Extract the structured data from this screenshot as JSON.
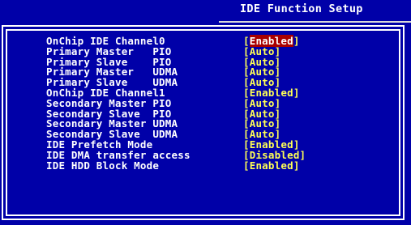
{
  "screen": {
    "title": "IDE Function Setup"
  },
  "colors": {
    "background": "#0000a8",
    "label": "#ffffff",
    "value": "#ffff54",
    "selected_bg": "#a80000"
  },
  "settings": [
    {
      "label": "OnChip IDE Channel0",
      "value": "Enabled",
      "selected": true
    },
    {
      "label": "Primary Master   PIO",
      "value": "Auto",
      "selected": false
    },
    {
      "label": "Primary Slave    PIO",
      "value": "Auto",
      "selected": false
    },
    {
      "label": "Primary Master   UDMA",
      "value": "Auto",
      "selected": false
    },
    {
      "label": "Primary Slave    UDMA",
      "value": "Auto",
      "selected": false
    },
    {
      "label": "OnChip IDE Channel1",
      "value": "Enabled",
      "selected": false
    },
    {
      "label": "Secondary Master PIO",
      "value": "Auto",
      "selected": false
    },
    {
      "label": "Secondary Slave  PIO",
      "value": "Auto",
      "selected": false
    },
    {
      "label": "Secondary Master UDMA",
      "value": "Auto",
      "selected": false
    },
    {
      "label": "Secondary Slave  UDMA",
      "value": "Auto",
      "selected": false
    },
    {
      "label": "IDE Prefetch Mode",
      "value": "Enabled",
      "selected": false
    },
    {
      "label": "IDE DMA transfer access",
      "value": "Disabled",
      "selected": false
    },
    {
      "label": "IDE HDD Block Mode",
      "value": "Enabled",
      "selected": false
    }
  ]
}
